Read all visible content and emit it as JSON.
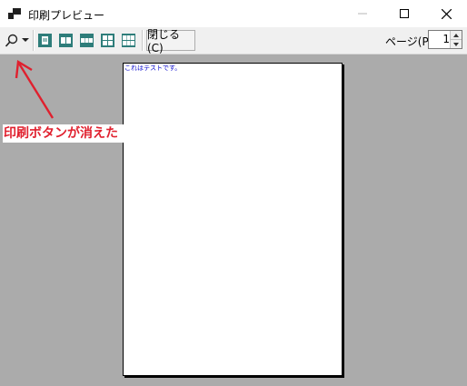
{
  "window": {
    "title": "印刷プレビュー",
    "controls": {
      "minimize": "—",
      "maximize": "☐",
      "close": "✕"
    }
  },
  "toolbar": {
    "zoom_icon": "magnifier-icon",
    "zoom_dropdown_icon": "chevron-down-icon",
    "layout_buttons": [
      "one-page-icon",
      "two-pages-icon",
      "three-pages-icon",
      "four-pages-icon",
      "six-pages-icon"
    ],
    "close_label": "閉じる(C)",
    "page_label": "ページ(P)",
    "page_value": "1"
  },
  "preview": {
    "page_text": "これはテストです。"
  },
  "annotation": {
    "text": "印刷ボタンが消えた",
    "color": "#e0202e"
  }
}
